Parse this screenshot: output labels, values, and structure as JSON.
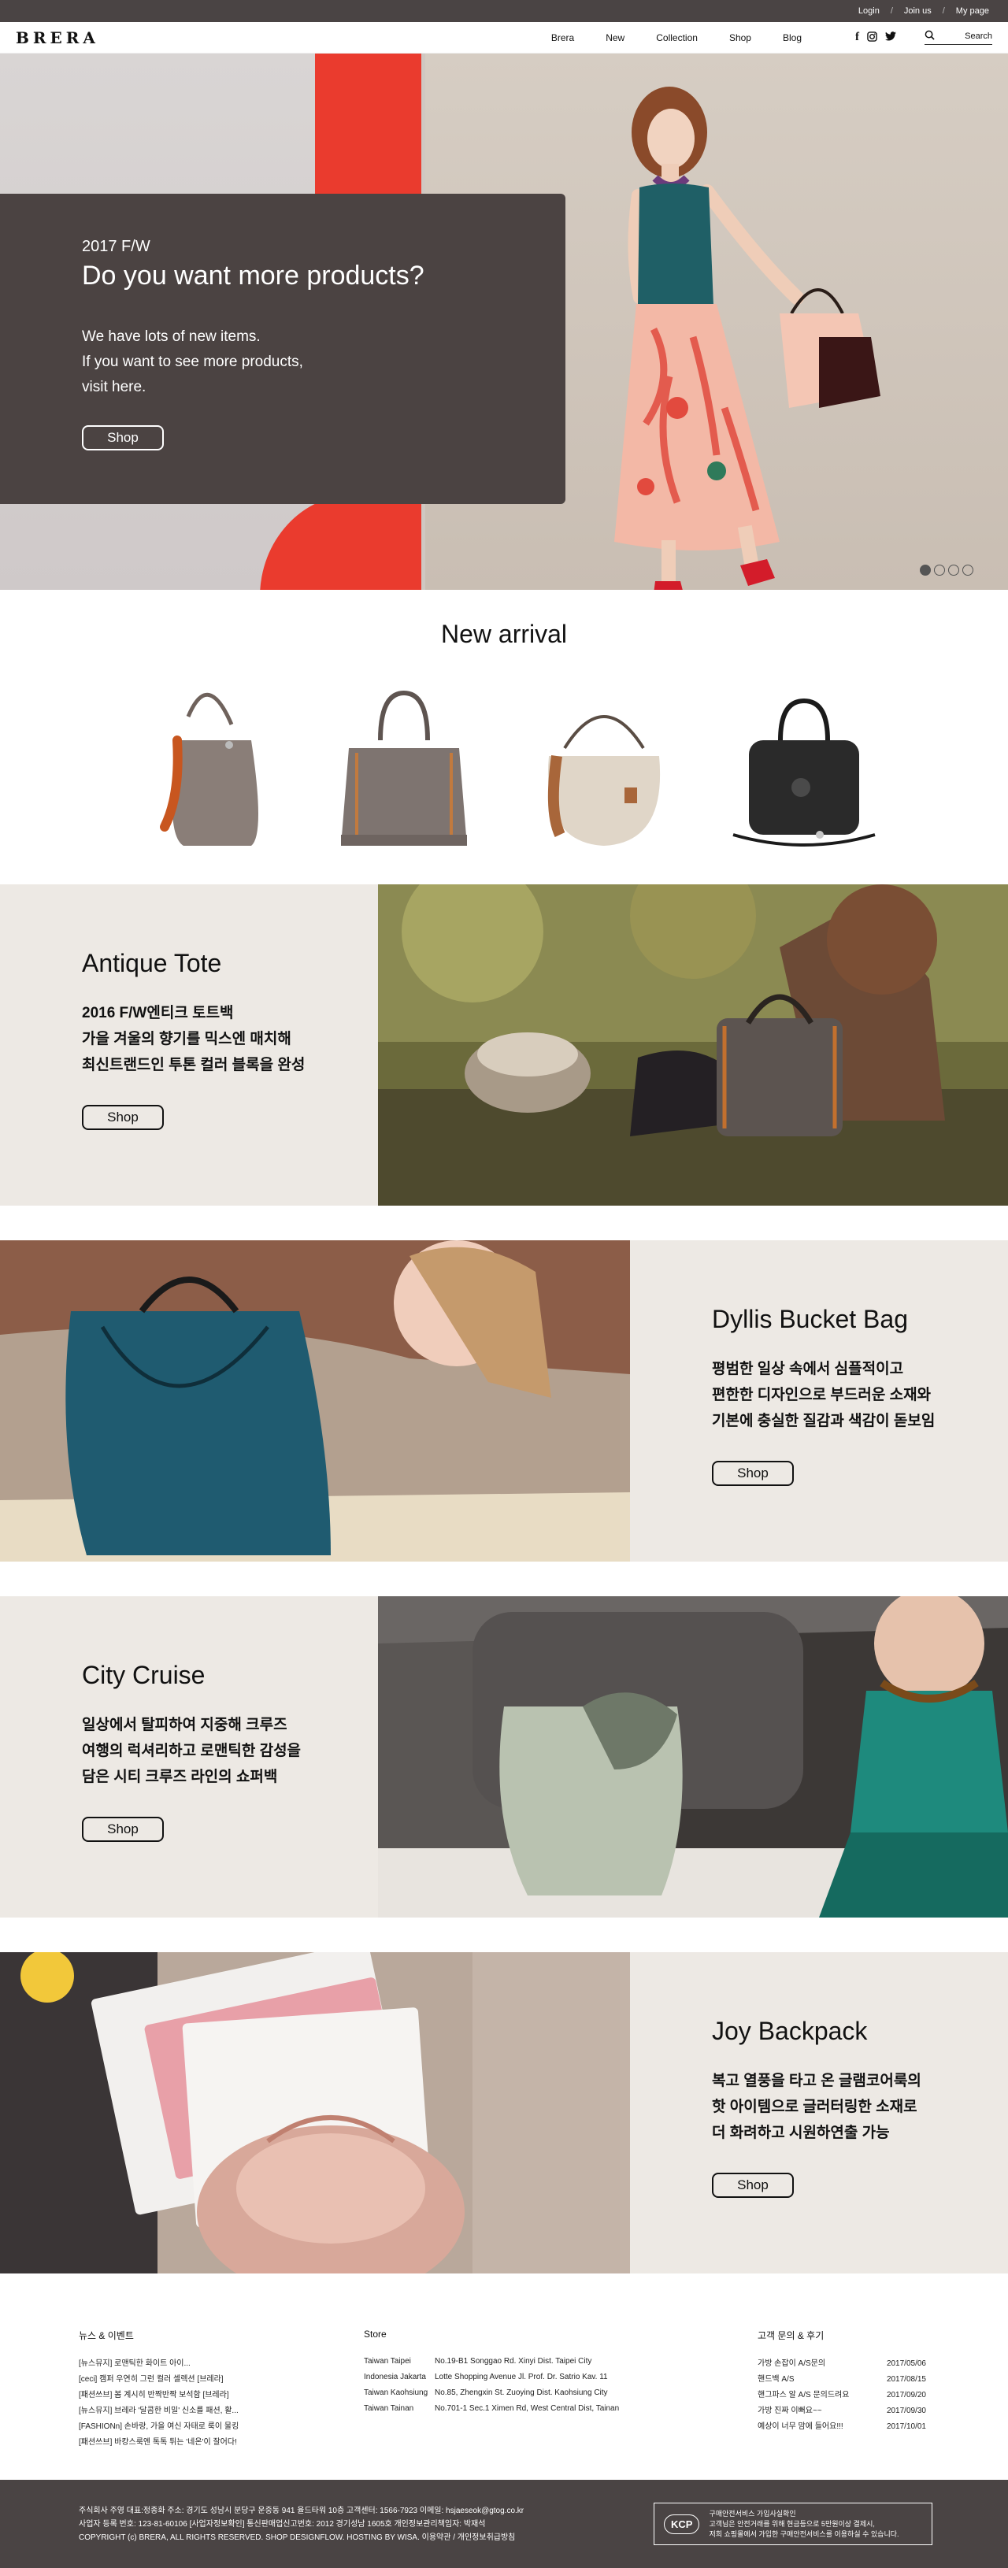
{
  "util_bar": {
    "login": "Login",
    "sep1": "/",
    "join": "Join us",
    "sep2": "/",
    "mypage": "My page"
  },
  "header": {
    "logo": "BRERA",
    "nav": [
      "Brera",
      "New",
      "Collection",
      "Shop",
      "Blog"
    ],
    "social": [
      "f",
      "◎",
      "🐦"
    ],
    "search_label": "Search"
  },
  "hero": {
    "season": "2017 F/W",
    "title": "Do you want more products?",
    "body_line1": "We have lots of new items.",
    "body_line2": "If you want to see more products,",
    "body_line3": "visit here.",
    "button": "Shop",
    "slides": 4,
    "active_slide": 1
  },
  "new_arrival": {
    "title": "New arrival",
    "products": [
      {
        "color": "#8a7e78",
        "accent": "#c8561f"
      },
      {
        "color": "#7e7470",
        "accent": "#c27a3e"
      },
      {
        "color": "#e0d6c8",
        "accent": "#a8663a"
      },
      {
        "color": "#2a2a2a",
        "accent": "#4a4a4a"
      }
    ]
  },
  "features": [
    {
      "title": "Antique Tote",
      "line1": "2016 F/W엔티크 토트백",
      "line2": "가을 겨울의 향기를 믹스엔 매치해",
      "line3": "최신트랜드인 투톤 컬러 블록을 완성",
      "button": "Shop"
    },
    {
      "title": "Dyllis Bucket Bag",
      "line1": "평범한 일상 속에서 심플적이고",
      "line2": "편한한 디자인으로 부드러운 소재와",
      "line3": "기본에 충실한 질감과 색감이 돋보임",
      "button": "Shop"
    },
    {
      "title": "City Cruise",
      "line1": "일상에서 탈피하여 지중해 크루즈",
      "line2": "여행의 럭셔리하고 로맨틱한 감성을",
      "line3": "담은 시티 크루즈 라인의 쇼퍼백",
      "button": "Shop"
    },
    {
      "title": "Joy Backpack",
      "line1": "복고 열풍을 타고 온 글램코어룩의",
      "line2": "핫 아이템으로 글러터링한 소재로",
      "line3": "더 화려하고 시원하연출 가능",
      "button": "Shop"
    }
  ],
  "footer": {
    "news_title": "뉴스 & 이벤트",
    "news": [
      "[뉴스뮤지] 로맨틱한 화이트 아이...",
      "[ceci] 캠퍼 우연히 그런 컬러 셀렉션 [브레라]",
      "[패션쓰브] 봄 계시히 반짝반짝 보석함 [브레라]",
      "[뉴스뮤지] 브레라 '달콤한 비밀' 신소를 패션, 활...",
      "[FASHIONn] 손바랑, 가을 여신 자태로 룩이 물킹",
      "[패션쓰브] 바캉스룩엔 톡톡 튀는 '네온'이 잘어다!"
    ],
    "store_title": "Store",
    "stores": [
      {
        "city": "Taiwan Taipei",
        "address": "No.19-B1 Songgao Rd. Xinyi Dist. Taipei City"
      },
      {
        "city": "Indonesia Jakarta",
        "address": "Lotte Shopping Avenue Jl. Prof. Dr. Satrio Kav. 11"
      },
      {
        "city": "Taiwan Kaohsiung",
        "address": "No.85, Zhengxin St. Zuoying Dist. Kaohsiung City"
      },
      {
        "city": "Taiwan Tainan",
        "address": "No.701-1 Sec.1 Ximen Rd, West Central Dist, Tainan"
      }
    ],
    "cs_title": "고객 문의 & 후기",
    "cs": [
      {
        "text": "가방 손잡이 A/S문의",
        "date": "2017/05/06"
      },
      {
        "text": "핸드백 A/S",
        "date": "2017/08/15"
      },
      {
        "text": "핸그파스 알 A/S 문의드려요",
        "date": "2017/09/20"
      },
      {
        "text": "가방 진짜 이뻐요~~",
        "date": "2017/09/30"
      },
      {
        "text": "예상이 너무 맘에 들어요!!!",
        "date": "2017/10/01"
      }
    ],
    "company_line1": "주식회사 주영   대표:정종화   주소: 경기도 성남시 분당구 운중동 941 율드타워 10층   고객센터: 1566-7923   이메일: hsjaeseok@gtog.co.kr",
    "company_line2": "사업자 등록 번호: 123-81-60106 [사업자정보확인]   통신판매업신고번호: 2012 경기성남 1605호   개인정보관리책임자: 박재석",
    "copyright": "COPYRIGHT (c) BRERA, ALL RIGHTS RESERVED. SHOP DESIGNFLOW. HOSTING BY WISA.   이용약관 / 개인정보취급방침",
    "kcp_logo": "KCP",
    "kcp_line1": "구매안전서비스 가입사실확인",
    "kcp_line2": "고객님은 안전거래를 위해 현금등으로 5만원이상 결제시,",
    "kcp_line3": "저희 쇼핑몰에서 가입한 구매안전서비스를 이용하실 수 있습니다."
  }
}
